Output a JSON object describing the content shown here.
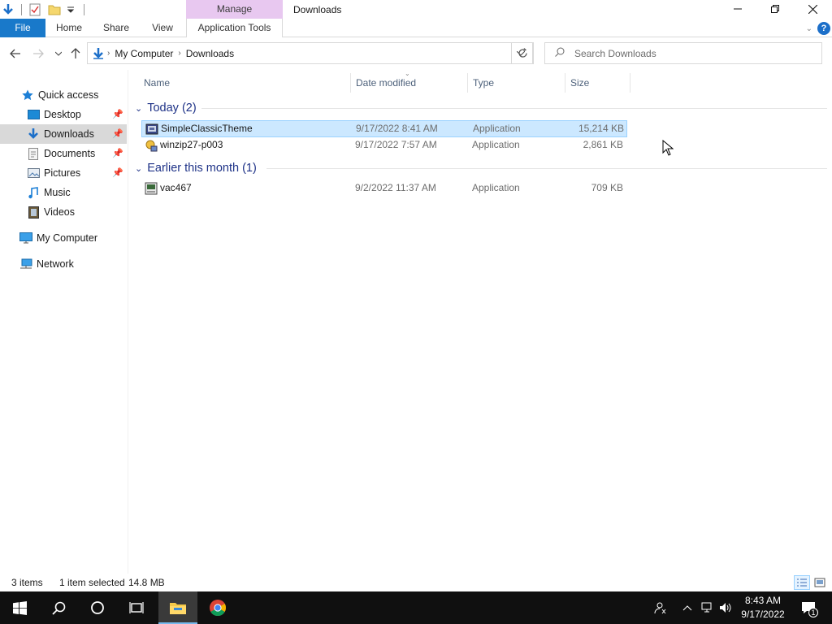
{
  "window": {
    "title": "Downloads",
    "context_tab": "Manage"
  },
  "ribbon": {
    "tabs": [
      {
        "label": "File"
      },
      {
        "label": "Home"
      },
      {
        "label": "Share"
      },
      {
        "label": "View"
      },
      {
        "label": "Application Tools"
      }
    ]
  },
  "address": {
    "breadcrumbs": [
      "My Computer",
      "Downloads"
    ]
  },
  "search": {
    "placeholder": "Search Downloads"
  },
  "navpane": {
    "items": [
      {
        "label": "Quick access",
        "icon": "star-icon"
      },
      {
        "label": "Desktop",
        "icon": "desktop-icon",
        "pinned": true
      },
      {
        "label": "Downloads",
        "icon": "download-icon",
        "pinned": true,
        "selected": true
      },
      {
        "label": "Documents",
        "icon": "documents-icon",
        "pinned": true
      },
      {
        "label": "Pictures",
        "icon": "pictures-icon",
        "pinned": true
      },
      {
        "label": "Music",
        "icon": "music-icon"
      },
      {
        "label": "Videos",
        "icon": "videos-icon"
      },
      {
        "label": "My Computer",
        "icon": "computer-icon"
      },
      {
        "label": "Network",
        "icon": "network-icon"
      }
    ]
  },
  "columns": [
    "Name",
    "Date modified",
    "Type",
    "Size"
  ],
  "groups": [
    {
      "label": "Today (2)",
      "files": [
        {
          "name": "SimpleClassicTheme",
          "date": "9/17/2022 8:41 AM",
          "type": "Application",
          "size": "15,214 KB",
          "selected": true
        },
        {
          "name": "winzip27-p003",
          "date": "9/17/2022 7:57 AM",
          "type": "Application",
          "size": "2,861 KB"
        }
      ]
    },
    {
      "label": "Earlier this month (1)",
      "files": [
        {
          "name": "vac467",
          "date": "9/2/2022 11:37 AM",
          "type": "Application",
          "size": "709 KB"
        }
      ]
    }
  ],
  "status": {
    "item_count": "3 items",
    "selection": "1 item selected",
    "selection_size": "14.8 MB"
  },
  "taskbar": {
    "clock_time": "8:43 AM",
    "clock_date": "9/17/2022",
    "notification_count": "1"
  },
  "colors": {
    "accent": "#1979ca",
    "selection": "#cce8ff",
    "group_header": "#1e3287",
    "context_tab": "#e8c8f0",
    "taskbar": "#101010"
  }
}
